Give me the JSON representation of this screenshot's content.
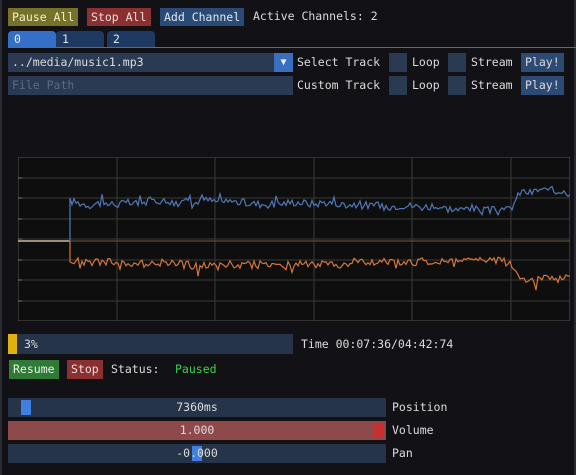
{
  "toolbar": {
    "pause_all": "Pause All",
    "stop_all": "Stop All",
    "add_channel": "Add Channel",
    "active_channels": "Active Channels: 2"
  },
  "tabs": [
    "0",
    "1",
    "2"
  ],
  "track_row": {
    "selected_track": "../media/music1.mp3",
    "select_label": "Select Track",
    "loop_label": "Loop",
    "stream_label": "Stream",
    "play_label": "Play!"
  },
  "custom_row": {
    "placeholder": "File Path",
    "custom_label": "Custom Track",
    "loop_label": "Loop",
    "stream_label": "Stream",
    "play_label": "Play!"
  },
  "waveform": {
    "colors": {
      "upper": "#4f78b8",
      "lower": "#d2773c",
      "baseline": "#c9b8a0",
      "grid": "#3a3a36"
    },
    "upper_levels": [
      40,
      38,
      36,
      38,
      37,
      37,
      38,
      37,
      40,
      41,
      39,
      38,
      40,
      38,
      41,
      39,
      40,
      39,
      38,
      37,
      37,
      36,
      38,
      39,
      38,
      37,
      39,
      37,
      36,
      37,
      36,
      35,
      34,
      35,
      36,
      35,
      34,
      35,
      33,
      32,
      31,
      33,
      30,
      31,
      29,
      33,
      50,
      48,
      52,
      49,
      51,
      50
    ],
    "lower_levels": [
      18,
      21,
      22,
      21,
      21,
      23,
      22,
      21,
      24,
      22,
      22,
      23,
      24,
      25,
      24,
      22,
      23,
      24,
      23,
      24,
      22,
      23,
      24,
      22,
      23,
      24,
      22,
      23,
      22,
      21,
      22,
      23,
      22,
      21,
      22,
      21,
      20,
      21,
      21,
      19,
      20,
      21,
      20,
      19,
      20,
      22,
      38,
      40,
      36,
      39,
      37,
      38
    ]
  },
  "progress": {
    "percent": 3,
    "label": "3%",
    "time_text": "Time 00:07:36/04:42:74"
  },
  "controls": {
    "resume": "Resume",
    "stop": "Stop",
    "status_label": "Status:",
    "status_value": "Paused",
    "status_color": "#3bd24a"
  },
  "sliders": {
    "position": {
      "label": "Position",
      "value_text": "7360ms",
      "fraction": 0.03
    },
    "volume": {
      "label": "Volume",
      "value_text": "1.000",
      "fraction": 1.0
    },
    "pan": {
      "label": "Pan",
      "value_text": "-0.000",
      "fraction": 0.5
    }
  }
}
